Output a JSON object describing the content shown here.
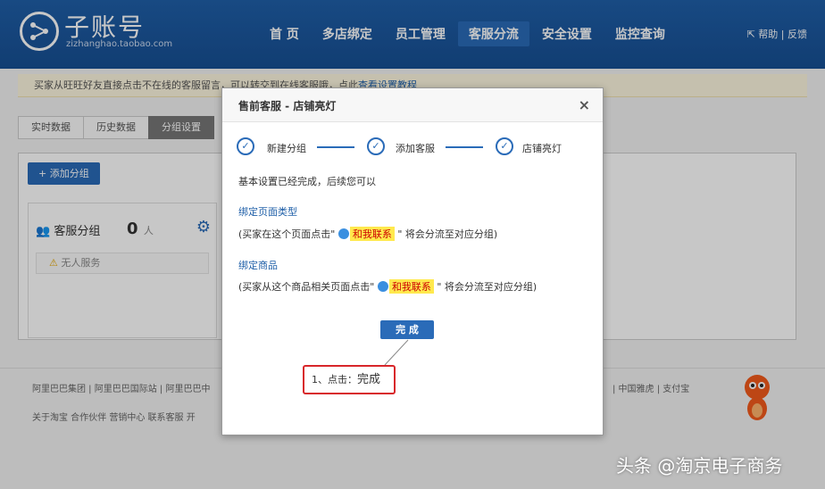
{
  "header": {
    "logo_title": "子账号",
    "logo_sub": "zizhanghao.taobao.com",
    "nav": [
      "首 页",
      "多店绑定",
      "员工管理",
      "客服分流",
      "安全设置",
      "监控查询"
    ],
    "active_nav": "客服分流",
    "help": "帮助 | 反馈"
  },
  "notice": {
    "text": "买家从旺旺好友直接点击不在线的客服留言，可以转交到在线客服哦，点此",
    "link": "查看设置教程"
  },
  "tabs": [
    "实时数据",
    "历史数据",
    "分组设置"
  ],
  "panel": {
    "add_button": "+ 添加分组",
    "group_title": "客服分组",
    "group_count": "0",
    "group_unit": "人",
    "no_service": "无人服务"
  },
  "footer": {
    "line1_left": "阿里巴巴集团 | 阿里巴巴国际站 | 阿里巴巴中",
    "line1_right": "| 中国雅虎 | 支付宝",
    "line2": "关于淘宝  合作伙伴  营销中心  联系客服  开"
  },
  "dialog": {
    "title": "售前客服 - 店铺亮灯",
    "close": "×",
    "steps": [
      "新建分组",
      "添加客服",
      "店铺亮灯"
    ],
    "intro": "基本设置已经完成，后续您可以",
    "section1_title": "绑定页面类型",
    "section1_pre": "(买家在这个页面点击\"",
    "section1_post": "\" 将会分流至对应分组)",
    "section2_title": "绑定商品",
    "section2_pre": "(买家从这个商品相关页面点击\"",
    "section2_post": "\" 将会分流至对应分组)",
    "contact_badge": "和我联系",
    "done_button": "完 成",
    "callout_prefix": "1、点击：",
    "callout_action": "完成"
  },
  "watermark": "头条 @淘京电子商务",
  "colors": {
    "header_blue": "#1f5fa8",
    "accent_blue": "#2a6bb8",
    "callout_red": "#d8262a",
    "badge_yellow": "#ffe94d"
  }
}
